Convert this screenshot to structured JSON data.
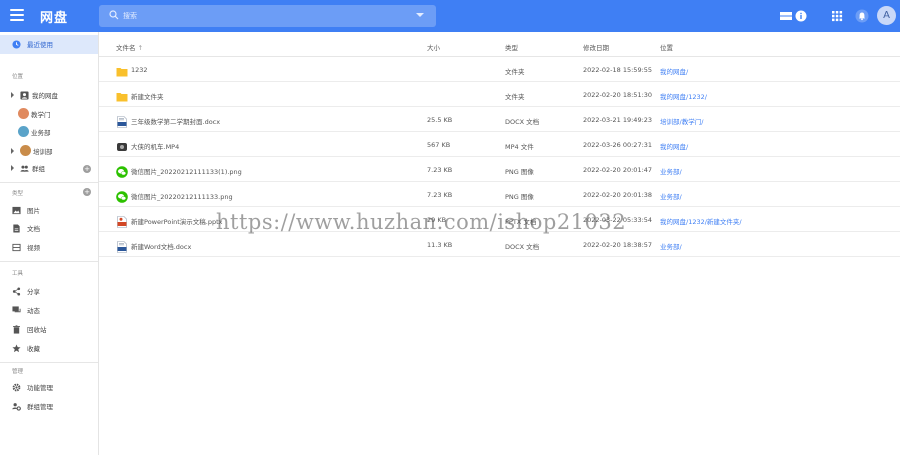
{
  "app": {
    "title": "网盘"
  },
  "search": {
    "placeholder": "搜索"
  },
  "user": {
    "avatar_letter": "A"
  },
  "colors": {
    "primary": "#3f7ff4",
    "active_bg": "#dde8fb",
    "folder": "#f9c02c",
    "wechat": "#2dc100",
    "docx": "#2b579a",
    "pptx": "#d24726"
  },
  "sidebar": {
    "recent": "最近使用",
    "section_location": "位置",
    "my_drive": "我的网盘",
    "groups": [
      "教学门",
      "业务部",
      "培训部"
    ],
    "group_bucket": "群组",
    "section_type": "类型",
    "types": [
      "图片",
      "文档",
      "视频"
    ],
    "section_tools": "工具",
    "tools": [
      "分享",
      "动态",
      "回收站",
      "收藏"
    ],
    "section_manage": "管理",
    "manage": [
      "功能管理",
      "群组管理"
    ]
  },
  "table": {
    "headers": {
      "name": "文件名",
      "size": "大小",
      "type": "类型",
      "modified": "修改日期",
      "location": "位置"
    },
    "rows": [
      {
        "icon": "folder-icon",
        "name": "1232",
        "size": "",
        "type": "文件夹",
        "modified": "2022-02-18 15:59:55",
        "location": "我的网盘/"
      },
      {
        "icon": "folder-icon",
        "name": "新建文件夹",
        "size": "",
        "type": "文件夹",
        "modified": "2022-02-20 18:51:30",
        "location": "我的网盘/1232/"
      },
      {
        "icon": "docx-icon",
        "name": "三年级数学第二学期封面.docx",
        "size": "25.5 KB",
        "type": "DOCX 文档",
        "modified": "2022-03-21 19:49:23",
        "location": "培训部/教学门/"
      },
      {
        "icon": "video-icon",
        "name": "大侠的机车.MP4",
        "size": "567 KB",
        "type": "MP4 文件",
        "modified": "2022-03-26 00:27:31",
        "location": "我的网盘/"
      },
      {
        "icon": "wechat-icon",
        "name": "微信图片_20220212111133(1).png",
        "size": "7.23 KB",
        "type": "PNG 图像",
        "modified": "2022-02-20 20:01:47",
        "location": "业务部/"
      },
      {
        "icon": "wechat-icon",
        "name": "微信图片_20220212111133.png",
        "size": "7.23 KB",
        "type": "PNG 图像",
        "modified": "2022-02-20 20:01:38",
        "location": "业务部/"
      },
      {
        "icon": "pptx-icon",
        "name": "新建PowerPoint演示文稿.pptx",
        "size": "29 KB",
        "type": "PPTX 文档",
        "modified": "2022-03-22 05:33:54",
        "location": "我的网盘/1232/新建文件夹/"
      },
      {
        "icon": "docx-icon",
        "name": "新建Word文档.docx",
        "size": "11.3 KB",
        "type": "DOCX 文档",
        "modified": "2022-02-20 18:38:57",
        "location": "业务部/"
      }
    ]
  },
  "watermark": "https://www.huzhan.com/ishop21032"
}
